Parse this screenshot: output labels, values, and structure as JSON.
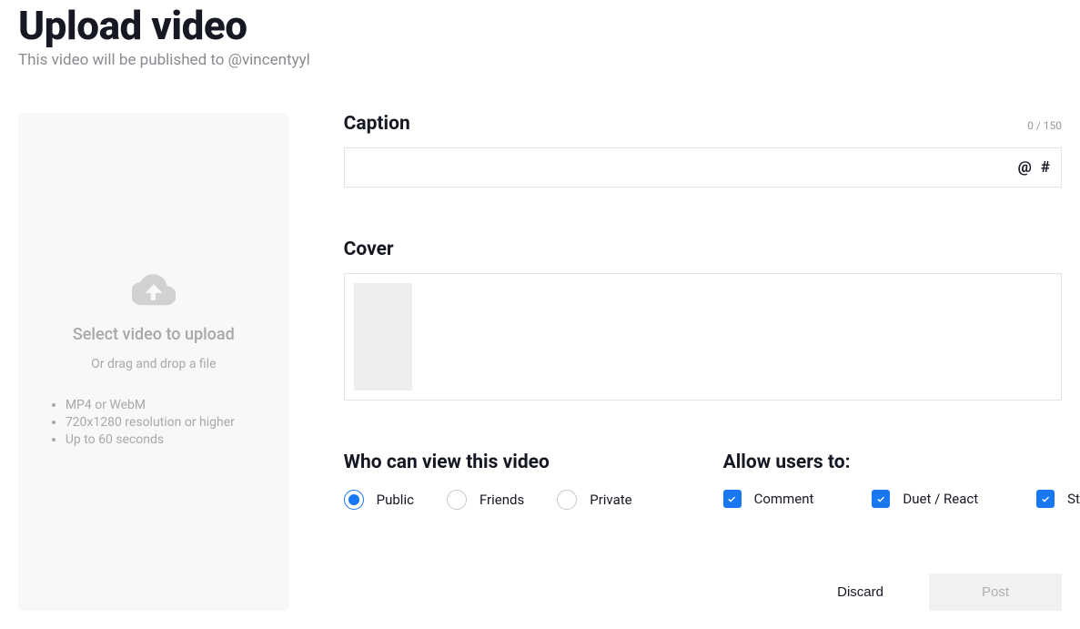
{
  "header": {
    "title": "Upload video",
    "subtitle": "This video will be published to @vincentyyl"
  },
  "upload": {
    "title": "Select video to upload",
    "subtitle": "Or drag and drop a file",
    "specs": [
      "MP4 or WebM",
      "720x1280 resolution or higher",
      "Up to 60 seconds"
    ]
  },
  "caption": {
    "label": "Caption",
    "counter": "0 / 150",
    "value": ""
  },
  "cover": {
    "label": "Cover"
  },
  "visibility": {
    "label": "Who can view this video",
    "options": {
      "public": "Public",
      "friends": "Friends",
      "private": "Private"
    },
    "selected": "public"
  },
  "permissions": {
    "label": "Allow users to:",
    "options": {
      "comment": "Comment",
      "duet": "Duet / React",
      "stitch": "Stitch"
    }
  },
  "actions": {
    "discard": "Discard",
    "post": "Post"
  }
}
